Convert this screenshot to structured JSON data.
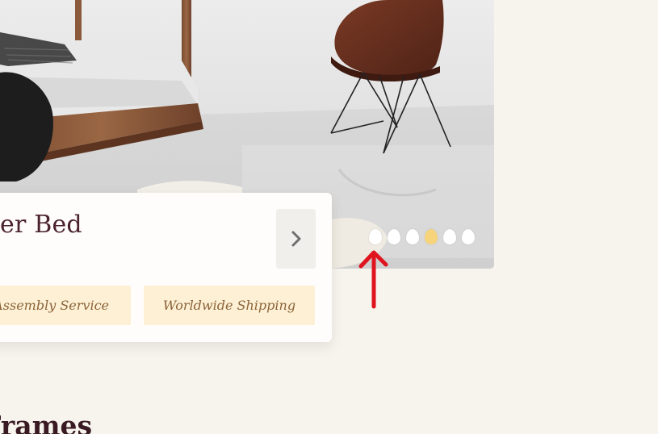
{
  "hero": {
    "image_label": "bedroom-scene-photo"
  },
  "carousel": {
    "dots": [
      {
        "active": false
      },
      {
        "active": false
      },
      {
        "active": false
      },
      {
        "active": true
      },
      {
        "active": false
      },
      {
        "active": false
      }
    ],
    "active_color": "#f7d47c",
    "inactive_color": "#ffffff"
  },
  "card": {
    "title": "er Bed",
    "next_icon": "chevron-right-icon",
    "features": [
      {
        "label": "d Assembly Service"
      },
      {
        "label": "Worldwide Shipping"
      }
    ]
  },
  "section": {
    "heading": "Frames"
  },
  "annotation": {
    "arrow_color": "#e0141e",
    "arrow_icon": "arrow-up-icon"
  },
  "colors": {
    "background": "#f7f4ee",
    "title_text": "#4a2230",
    "feature_bg": "#fdf0d4",
    "feature_text": "#8b6339"
  }
}
